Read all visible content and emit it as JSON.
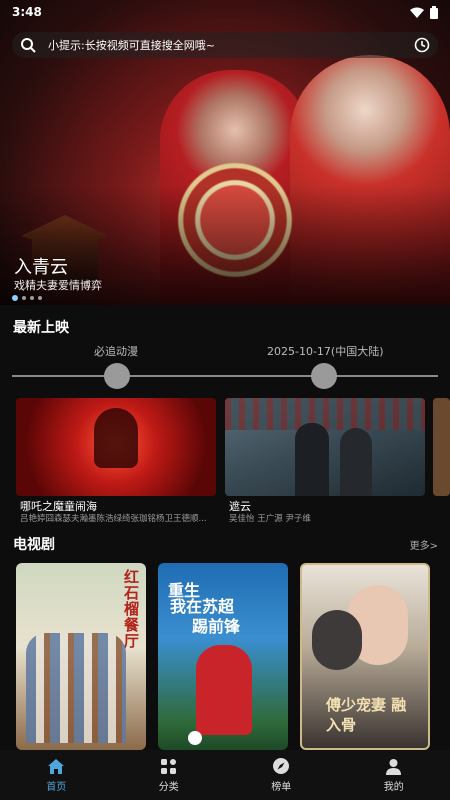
{
  "status": {
    "time": "3:48"
  },
  "search": {
    "hint": "小提示:长按视频可直接搜全网哦~"
  },
  "hero": {
    "title": "入青云",
    "subtitle": "戏精夫妻爱情博弈",
    "active_index": 0,
    "dot_count": 4
  },
  "latest": {
    "heading": "最新上映",
    "timeline": [
      {
        "label": "必追动漫"
      },
      {
        "label": "2025-10-17(中国大陆)"
      }
    ],
    "items": [
      {
        "title": "哪吒之魔童闹海",
        "cast": "吕艳婷囧森瑟夫瀚墨陈浩绿绮张珈铭杨卫王德顺..."
      },
      {
        "title": "遮云",
        "cast": "吴佳怡 王广源 尹子维"
      }
    ]
  },
  "tv": {
    "heading": "电视剧",
    "more": "更多>",
    "posters": [
      {
        "text": "红石榴餐厅"
      },
      {
        "text_line1": "重生",
        "text_line2": "我在苏超",
        "text_line3": "踢前锋"
      },
      {
        "text": "傅少宠妻 融入骨"
      }
    ]
  },
  "nav": [
    {
      "label": "首页",
      "icon": "home-icon",
      "active": true
    },
    {
      "label": "分类",
      "icon": "category-icon",
      "active": false
    },
    {
      "label": "榜单",
      "icon": "compass-icon",
      "active": false
    },
    {
      "label": "我的",
      "icon": "user-icon",
      "active": false
    }
  ],
  "colors": {
    "accent": "#4fa6dc",
    "background": "#0d0d0d"
  }
}
